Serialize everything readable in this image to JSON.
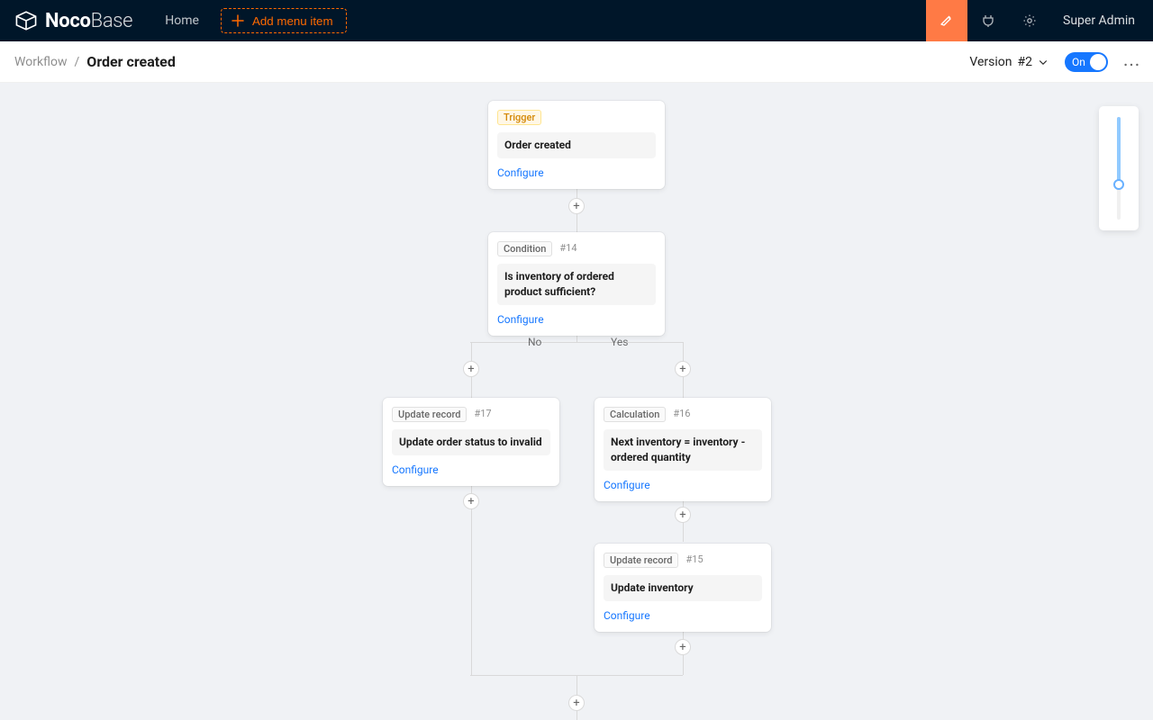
{
  "nav": {
    "brand_main": "Noco",
    "brand_sub": "Base",
    "home": "Home",
    "add_menu": "Add menu item",
    "user": "Super Admin"
  },
  "header": {
    "breadcrumb_root": "Workflow",
    "breadcrumb_current": "Order created",
    "version_label": "Version",
    "version_number": "#2",
    "toggle_label": "On"
  },
  "branches": {
    "no": "No",
    "yes": "Yes"
  },
  "links": {
    "configure": "Configure"
  },
  "nodes": {
    "trigger": {
      "tag": "Trigger",
      "title": "Order created"
    },
    "cond": {
      "type": "Condition",
      "id": "#14",
      "title": "Is inventory of ordered product sufficient?"
    },
    "update_invalid": {
      "type": "Update record",
      "id": "#17",
      "title": "Update order status to invalid"
    },
    "calc": {
      "type": "Calculation",
      "id": "#16",
      "title": "Next inventory = inventory - ordered quantity"
    },
    "update_inv": {
      "type": "Update record",
      "id": "#15",
      "title": "Update inventory"
    }
  }
}
